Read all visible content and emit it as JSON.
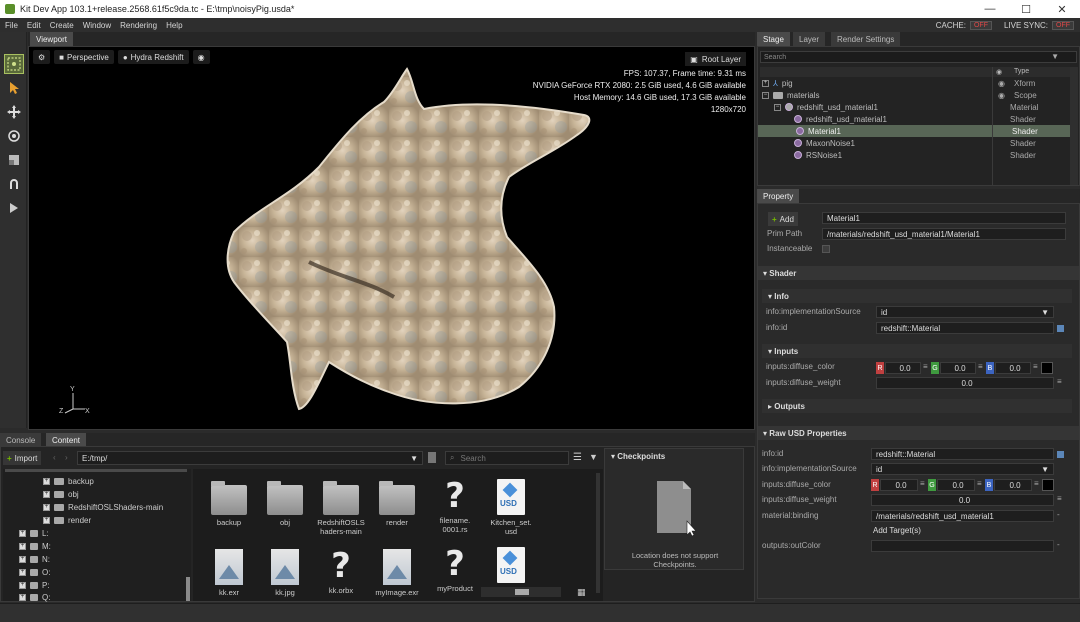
{
  "window": {
    "title": "Kit Dev App 103.1+release.2568.61f5c9da.tc - E:\\tmp\\noisyPig.usda*",
    "controls": {
      "minimize": "—",
      "maximize": "☐",
      "close": "✕"
    }
  },
  "menubar": {
    "items": [
      "File",
      "Edit",
      "Create",
      "Window",
      "Rendering",
      "Help"
    ],
    "cache_label": "CACHE:",
    "cache_state": "OFF",
    "live_sync_label": "LIVE SYNC:",
    "live_sync_state": "OFF"
  },
  "viewport": {
    "tab": "Viewport",
    "camera": "Perspective",
    "renderer": "Hydra Redshift",
    "root_layer": "Root Layer",
    "stats": [
      "FPS: 107.37, Frame time: 9.31 ms",
      "NVIDIA GeForce RTX 2080: 2.5 GiB used, 4.6 GiB available",
      "Host Memory: 14.6 GiB used, 17.3 GiB available",
      "1280x720"
    ],
    "axis": {
      "y": "Y",
      "z": "Z",
      "x": "X"
    }
  },
  "stage": {
    "tabs": [
      "Stage",
      "Layer",
      "Render Settings"
    ],
    "search_placeholder": "Search",
    "type_header": "Type",
    "rows": [
      {
        "name": "pig",
        "type": "Xform"
      },
      {
        "name": "materials",
        "type": "Scope"
      },
      {
        "name": "redshift_usd_material1",
        "type": "Material"
      },
      {
        "name": "redshift_usd_material1",
        "type": "Shader"
      },
      {
        "name": "Material1",
        "type": "Shader"
      },
      {
        "name": "MaxonNoise1",
        "type": "Shader"
      },
      {
        "name": "RSNoise1",
        "type": "Shader"
      }
    ]
  },
  "property": {
    "tab": "Property",
    "add_label": "Add",
    "name_value": "Material1",
    "prim_path_label": "Prim Path",
    "prim_path_value": "/materials/redshift_usd_material1/Material1",
    "instanceable_label": "Instanceable",
    "shader_section": "Shader",
    "info_section": "Info",
    "impl_source_label": "info:implementationSource",
    "impl_source_value": "id",
    "info_id_label": "info:id",
    "info_id_value": "redshift::Material",
    "inputs_section": "Inputs",
    "diffuse_color_label": "inputs:diffuse_color",
    "diffuse_color": {
      "r": "0.0",
      "g": "0.0",
      "b": "0.0"
    },
    "diffuse_weight_label": "inputs:diffuse_weight",
    "diffuse_weight_value": "0.0",
    "outputs_section": "Outputs",
    "raw_section": "Raw USD Properties",
    "raw": {
      "info_id_label": "info:id",
      "info_id_value": "redshift::Material",
      "impl_label": "info:implementationSource",
      "impl_value": "id",
      "diffuse_color_label": "inputs:diffuse_color",
      "diffuse_color": {
        "r": "0.0",
        "g": "0.0",
        "b": "0.0"
      },
      "diffuse_weight_label": "inputs:diffuse_weight",
      "diffuse_weight_value": "0.0",
      "binding_label": "material:binding",
      "binding_value": "/materials/redshift_usd_material1",
      "add_targets": "Add Target(s)",
      "out_color_label": "outputs:outColor"
    },
    "channel_letters": {
      "r": "R",
      "g": "G",
      "b": "B"
    }
  },
  "content": {
    "tabs": [
      "Console",
      "Content"
    ],
    "import_label": "Import",
    "path_value": "E:/tmp/",
    "search_placeholder": "Search",
    "tree": [
      "backup",
      "obj",
      "RedshiftOSLShaders-main",
      "render"
    ],
    "drives": [
      "L:",
      "M:",
      "N:",
      "O:",
      "P:",
      "Q:"
    ],
    "files": [
      {
        "name": "backup",
        "kind": "folder"
      },
      {
        "name": "obj",
        "kind": "folder"
      },
      {
        "name": "RedshiftOSLShaders-main",
        "kind": "folder"
      },
      {
        "name": "render",
        "kind": "folder"
      },
      {
        "name": "filename.0001.rs",
        "kind": "unknown"
      },
      {
        "name": "Kitchen_set.usd",
        "kind": "usd"
      },
      {
        "name": "kk.exr",
        "kind": "image"
      },
      {
        "name": "kk.jpg",
        "kind": "image"
      },
      {
        "name": "kk.orbx",
        "kind": "unknown"
      },
      {
        "name": "myImage.exr",
        "kind": "image"
      },
      {
        "name": "myProduct",
        "kind": "unknown"
      },
      {
        "name": "",
        "kind": "usd"
      }
    ],
    "file_labels": {
      "f0": "backup",
      "f1": "obj",
      "f2a": "RedshiftOSLS",
      "f2b": "haders-main",
      "f3": "render",
      "f4a": "filename.",
      "f4b": "0001.rs",
      "f5a": "Kitchen_set.",
      "f5b": "usd",
      "f6": "kk.exr",
      "f7": "kk.jpg",
      "f8": "kk.orbx",
      "f9": "myImage.exr",
      "f10": "myProduct"
    },
    "usd_badge": "USD"
  },
  "checkpoints": {
    "title": "Checkpoints",
    "message_line1": "Location does not support",
    "message_line2": "Checkpoints."
  },
  "colors": {
    "accent_green": "#76b900",
    "selection": "#586656",
    "off_red": "#e04848",
    "chan_r": "#c04040",
    "chan_g": "#3f9a3f",
    "chan_b": "#3c64c0"
  }
}
